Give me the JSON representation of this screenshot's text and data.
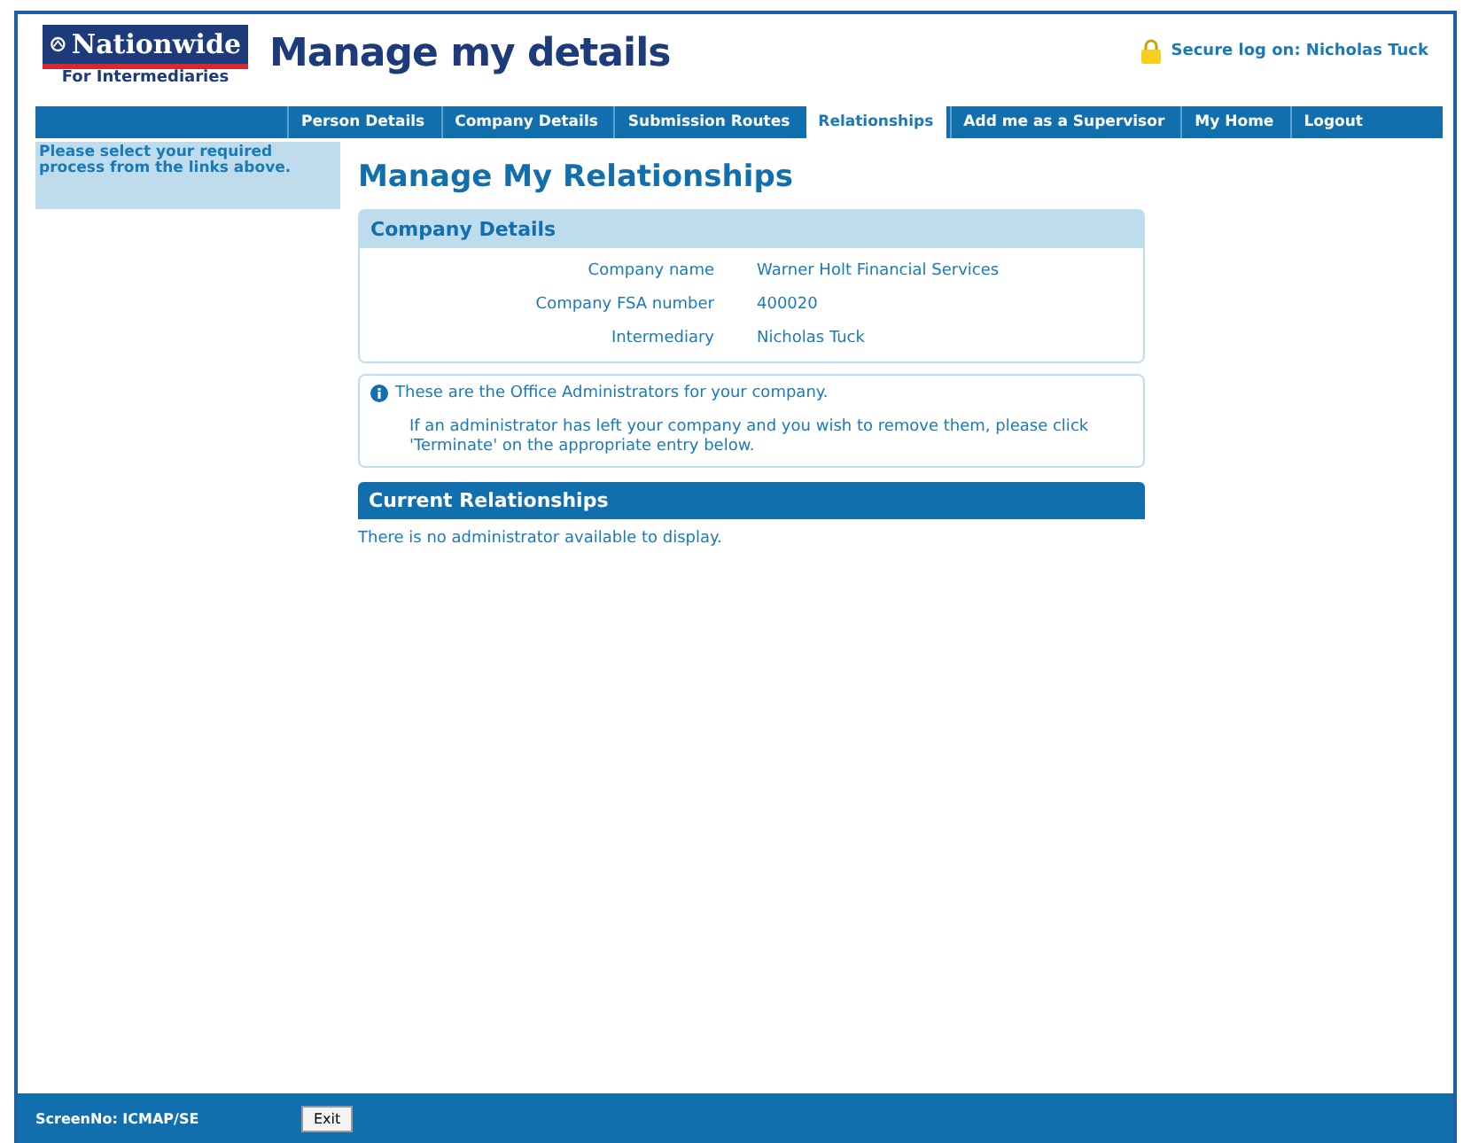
{
  "header": {
    "brand": "Nationwide",
    "brand_sub": "For Intermediaries",
    "title": "Manage my details",
    "secure": "Secure log on: Nicholas Tuck"
  },
  "tabs": [
    {
      "label": "Person Details",
      "selected": false
    },
    {
      "label": "Company Details",
      "selected": false
    },
    {
      "label": "Submission Routes",
      "selected": false
    },
    {
      "label": "Relationships",
      "selected": true
    },
    {
      "label": "Add me as a Supervisor",
      "selected": false
    },
    {
      "label": "My Home",
      "selected": false
    },
    {
      "label": "Logout",
      "selected": false
    }
  ],
  "sidebar": {
    "text": "Please select your required process from the links above."
  },
  "page_title": "Manage My Relationships",
  "company_details": {
    "heading": "Company Details",
    "fields": [
      {
        "label": "Company name",
        "value": "Warner Holt Financial Services"
      },
      {
        "label": "Company FSA number",
        "value": "400020"
      },
      {
        "label": "Intermediary",
        "value": "Nicholas Tuck"
      }
    ]
  },
  "info": {
    "lines": [
      "These are the Office Administrators for your company.",
      "If an administrator has left your company and you wish to remove them, please click 'Terminate' on the appropriate entry below."
    ]
  },
  "relationships": {
    "heading": "Current Relationships",
    "empty": "There is no administrator available to display."
  },
  "footer": {
    "screen_no": "ScreenNo: ICMAP/SE",
    "button": "Exit"
  }
}
